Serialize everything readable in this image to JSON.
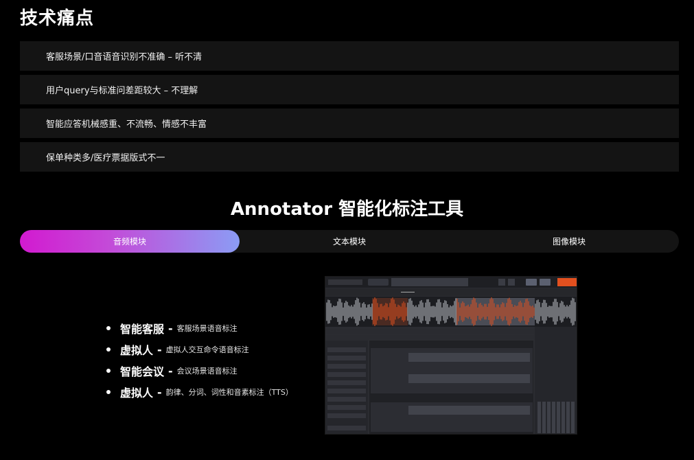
{
  "pain_points": {
    "title": "技术痛点",
    "items": [
      "客服场景/口音语音识别不准确 – 听不清",
      "用户query与标准问差距较大 – 不理解",
      "智能应答机械感重、不流畅、情感不丰富",
      "保单种类多/医疗票据版式不一"
    ]
  },
  "annotator": {
    "title": "Annotator 智能化标注工具",
    "tabs": [
      {
        "label": "音频模块",
        "active": true
      },
      {
        "label": "文本模块",
        "active": false
      },
      {
        "label": "图像模块",
        "active": false
      }
    ],
    "features": [
      {
        "title": "智能客服",
        "separator": "-",
        "desc": "客服场景语音标注"
      },
      {
        "title": "虚拟人",
        "separator": "-",
        "desc": "虚拟人交互命令语音标注"
      },
      {
        "title": "智能会议",
        "separator": "-",
        "desc": "会议场景语音标注"
      },
      {
        "title": "虚拟人",
        "separator": "-",
        "desc": "韵律、分词、词性和音素标注（TTS）"
      }
    ]
  },
  "colors": {
    "background": "#000000",
    "panel": "#141414",
    "tab_gradient_start": "#d21ad0",
    "tab_gradient_end": "#8b9cf4",
    "waveform_highlight": "#e2501f"
  }
}
